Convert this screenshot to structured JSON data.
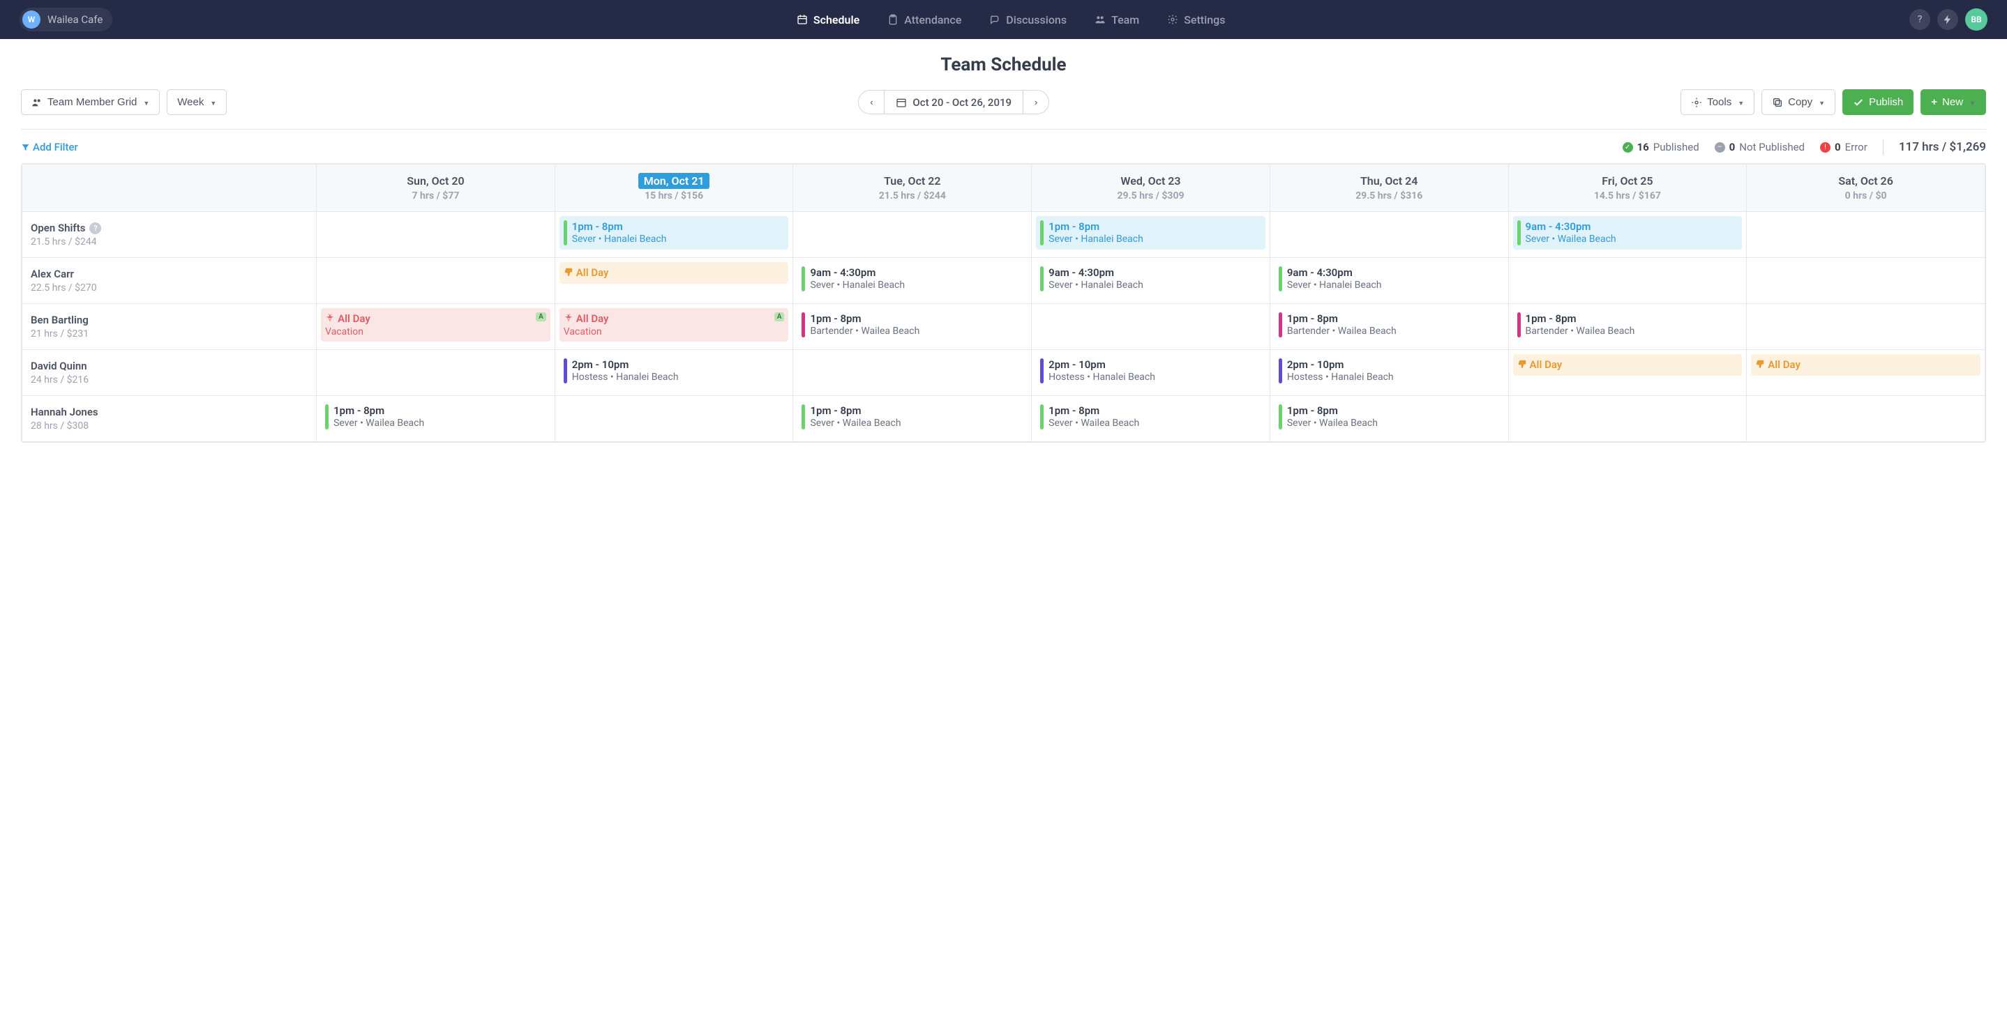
{
  "brand": {
    "initial": "W",
    "name": "Wailea Cafe"
  },
  "nav": {
    "schedule": "Schedule",
    "attendance": "Attendance",
    "discussions": "Discussions",
    "team": "Team",
    "settings": "Settings"
  },
  "user": {
    "initials": "BB"
  },
  "page_title": "Team Schedule",
  "controls": {
    "view_mode": "Team Member Grid",
    "timespan": "Week",
    "date_range": "Oct 20 - Oct 26, 2019",
    "tools": "Tools",
    "copy": "Copy",
    "publish": "Publish",
    "new": "New"
  },
  "filter": {
    "add": "Add Filter"
  },
  "status": {
    "published_count": "16",
    "published_label": "Published",
    "notpub_count": "0",
    "notpub_label": "Not Published",
    "error_count": "0",
    "error_label": "Error",
    "total": "117 hrs / $1,269"
  },
  "days": [
    {
      "label": "Sun, Oct 20",
      "sub": "7 hrs / $77",
      "today": false
    },
    {
      "label": "Mon, Oct 21",
      "sub": "15 hrs / $156",
      "today": true
    },
    {
      "label": "Tue, Oct 22",
      "sub": "21.5 hrs / $244",
      "today": false
    },
    {
      "label": "Wed, Oct 23",
      "sub": "29.5 hrs / $309",
      "today": false
    },
    {
      "label": "Thu, Oct 24",
      "sub": "29.5 hrs / $316",
      "today": false
    },
    {
      "label": "Fri, Oct 25",
      "sub": "14.5 hrs / $167",
      "today": false
    },
    {
      "label": "Sat, Oct 26",
      "sub": "0 hrs / $0",
      "today": false
    }
  ],
  "rows": [
    {
      "name": "Open Shifts",
      "help": true,
      "sub": "21.5 hrs / $244",
      "cells": [
        null,
        {
          "kind": "open",
          "bar": "green",
          "time": "1pm - 8pm",
          "desc": "Sever • Hanalei Beach"
        },
        null,
        {
          "kind": "open",
          "bar": "green",
          "time": "1pm - 8pm",
          "desc": "Sever • Hanalei Beach"
        },
        null,
        {
          "kind": "open",
          "bar": "green",
          "time": "9am - 4:30pm",
          "desc": "Sever • Wailea Beach"
        },
        null
      ]
    },
    {
      "name": "Alex Carr",
      "sub": "22.5 hrs / $270",
      "cells": [
        null,
        {
          "kind": "ooo",
          "icon": "thumbs-down",
          "time": "All Day"
        },
        {
          "kind": "normal",
          "bar": "green",
          "time": "9am - 4:30pm",
          "desc": "Sever • Hanalei Beach"
        },
        {
          "kind": "normal",
          "bar": "green",
          "time": "9am - 4:30pm",
          "desc": "Sever • Hanalei Beach"
        },
        {
          "kind": "normal",
          "bar": "green",
          "time": "9am - 4:30pm",
          "desc": "Sever • Hanalei Beach"
        },
        null,
        null
      ]
    },
    {
      "name": "Ben Bartling",
      "sub": "21 hrs / $231",
      "cells": [
        {
          "kind": "vac",
          "icon": "palm",
          "time": "All Day",
          "desc": "Vacation",
          "badge": "A"
        },
        {
          "kind": "vac",
          "icon": "palm",
          "time": "All Day",
          "desc": "Vacation",
          "badge": "A"
        },
        {
          "kind": "normal",
          "bar": "pink",
          "time": "1pm - 8pm",
          "desc": "Bartender • Wailea Beach"
        },
        null,
        {
          "kind": "normal",
          "bar": "pink",
          "time": "1pm - 8pm",
          "desc": "Bartender • Wailea Beach"
        },
        {
          "kind": "normal",
          "bar": "pink",
          "time": "1pm - 8pm",
          "desc": "Bartender • Wailea Beach"
        },
        null
      ]
    },
    {
      "name": "David Quinn",
      "sub": "24 hrs / $216",
      "cells": [
        null,
        {
          "kind": "normal",
          "bar": "purple",
          "time": "2pm - 10pm",
          "desc": "Hostess • Hanalei Beach"
        },
        null,
        {
          "kind": "normal",
          "bar": "purple",
          "time": "2pm - 10pm",
          "desc": "Hostess • Hanalei Beach"
        },
        {
          "kind": "normal",
          "bar": "purple",
          "time": "2pm - 10pm",
          "desc": "Hostess • Hanalei Beach"
        },
        {
          "kind": "ooo",
          "icon": "thumbs-down",
          "time": "All Day"
        },
        {
          "kind": "ooo",
          "icon": "thumbs-down",
          "time": "All Day"
        }
      ]
    },
    {
      "name": "Hannah Jones",
      "sub": "28 hrs / $308",
      "cells": [
        {
          "kind": "normal",
          "bar": "green",
          "time": "1pm - 8pm",
          "desc": "Sever • Wailea Beach"
        },
        null,
        {
          "kind": "normal",
          "bar": "green",
          "time": "1pm - 8pm",
          "desc": "Sever • Wailea Beach"
        },
        {
          "kind": "normal",
          "bar": "green",
          "time": "1pm - 8pm",
          "desc": "Sever • Wailea Beach"
        },
        {
          "kind": "normal",
          "bar": "green",
          "time": "1pm - 8pm",
          "desc": "Sever • Wailea Beach"
        },
        null,
        null
      ]
    }
  ]
}
